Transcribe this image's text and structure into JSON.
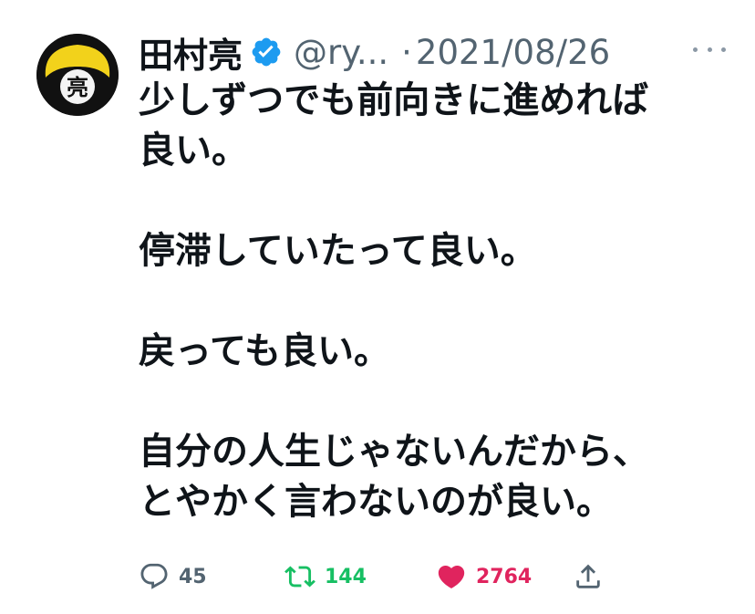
{
  "tweet": {
    "author": {
      "name": "田村亮",
      "handle": "@ry...",
      "avatar_icon": "avatar-kanji-ryo",
      "avatar_char": "亮",
      "verified_icon": "verified-badge-icon"
    },
    "separator": "·",
    "date": "2021/08/26",
    "lines": [
      "少しずつでも前向きに進めれば",
      "良い。",
      "",
      "停滞していたって良い。",
      "",
      "戻っても良い。",
      "",
      "自分の人生じゃないんだから、",
      "とやかく言わないのが良い。"
    ],
    "actions": {
      "reply_count": "45",
      "retweet_count": "144",
      "like_count": "2764"
    }
  },
  "colors": {
    "text": "#0f1419",
    "secondary": "#536471",
    "verified": "#1d9bf0",
    "retweet": "#17bf63",
    "like": "#e0245e"
  }
}
